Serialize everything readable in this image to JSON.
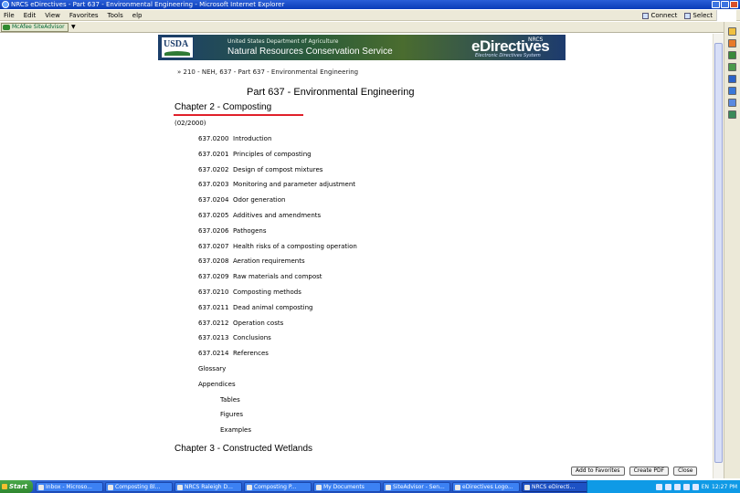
{
  "window": {
    "title": "NRCS eDirectives - Part 637 - Environmental Engineering - Microsoft Internet Explorer"
  },
  "menubar": {
    "items": [
      "File",
      "Edit",
      "View",
      "Favorites",
      "Tools",
      "elp"
    ],
    "right": {
      "connect": "Connect",
      "select": "Select"
    }
  },
  "toolbar": {
    "mcafee_label": "McAfee SiteAdvisor"
  },
  "banner": {
    "usda": "USDA",
    "dept": "United States Department of Agriculture",
    "nrcs": "Natural Resources Conservation Service",
    "edirectives": "eDirectives",
    "tagline": "Electronic Directives System",
    "mark": "NRCS"
  },
  "page": {
    "breadcrumb": "» 210 - NEH, 637 - Part 637 - Environmental Engineering",
    "title": "Part 637 - Environmental Engineering",
    "chapter2": "Chapter 2 - Composting",
    "date": "(02/2000)",
    "toc": [
      {
        "code": "637.0200",
        "label": "Introduction"
      },
      {
        "code": "637.0201",
        "label": "Principles of composting"
      },
      {
        "code": "637.0202",
        "label": "Design of compost mixtures"
      },
      {
        "code": "637.0203",
        "label": "Monitoring and parameter adjustment"
      },
      {
        "code": "637.0204",
        "label": "Odor generation"
      },
      {
        "code": "637.0205",
        "label": "Additives and amendments"
      },
      {
        "code": "637.0206",
        "label": "Pathogens"
      },
      {
        "code": "637.0207",
        "label": "Health risks of a composting operation"
      },
      {
        "code": "637.0208",
        "label": "Aeration requirements"
      },
      {
        "code": "637.0209",
        "label": "Raw materials and compost"
      },
      {
        "code": "637.0210",
        "label": "Composting methods"
      },
      {
        "code": "637.0211",
        "label": "Dead animal composting"
      },
      {
        "code": "637.0212",
        "label": "Operation costs"
      },
      {
        "code": "637.0213",
        "label": "Conclusions"
      },
      {
        "code": "637.0214",
        "label": "References"
      }
    ],
    "glossary": "Glossary",
    "appendices": "Appendices",
    "appendix_items": [
      "Tables",
      "Figures",
      "Examples"
    ],
    "chapter3": "Chapter 3 - Constructed Wetlands",
    "buttons": {
      "favorites": "Add to Favorites",
      "pdf": "Create PDF",
      "close": "Close"
    }
  },
  "taskbar": {
    "start": "Start",
    "tasks": [
      "Inbox - Microso...",
      "Composting Bl...",
      "NRCS Raleigh D...",
      "Composting P...",
      "My Documents",
      "SiteAdvisor - Sen...",
      "eDirectives Logo...",
      "NRCS eDirecti..."
    ],
    "lang": "EN",
    "clock": "12:27 PM"
  },
  "colors": {
    "chapter_underline": "#e0202a",
    "titlebar": "#0a3cb8",
    "taskbar": "#1f4fbf"
  }
}
